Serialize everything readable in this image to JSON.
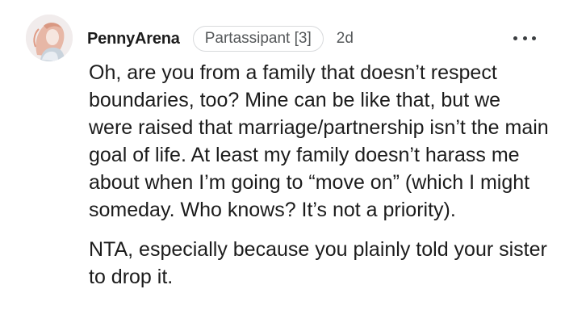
{
  "comment": {
    "author": "PennyArena",
    "flair": "Partassipant [3]",
    "timestamp": "2d",
    "more_icon": "more-options-icon",
    "avatar_icon": "user-avatar",
    "paragraphs": [
      "Oh, are you from a family that doesn’t respect boundaries, too? Mine can be like that, but we were raised that marriage/partnership isn’t the main goal of life. At least my family doesn’t harass me about when I’m going to “move on” (which I might someday. Who knows? It’s not a priority).",
      "NTA, especially because you plainly told your sister to drop it."
    ]
  }
}
